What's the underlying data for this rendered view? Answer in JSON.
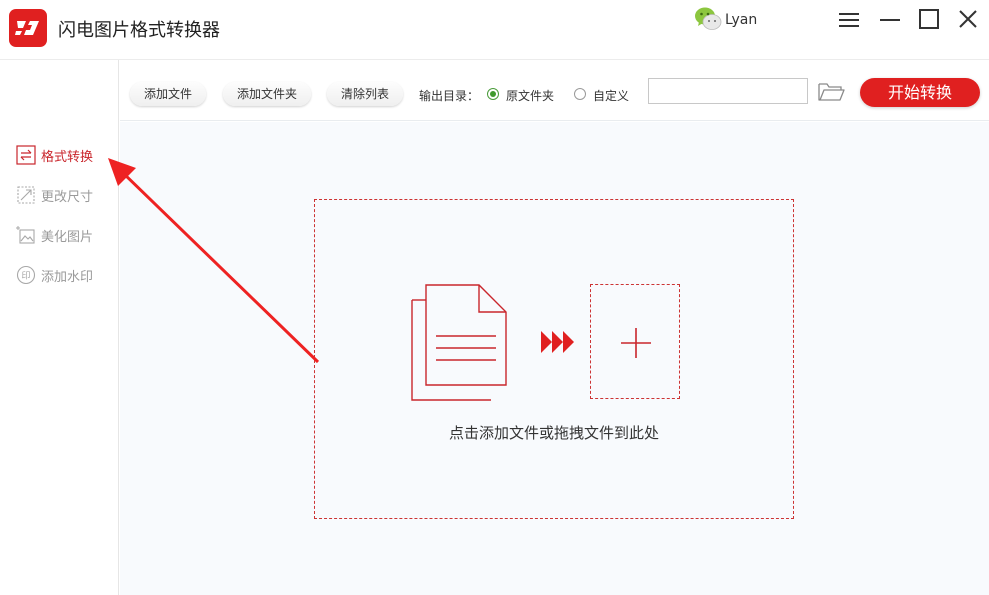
{
  "app": {
    "title": "闪电图片格式转换器",
    "user_name": "Lyan"
  },
  "colors": {
    "accent": "#e02020",
    "active_text": "#c9262c",
    "radio_checked": "#3f9a2d",
    "dropzone_border": "#cc3333"
  },
  "icons": {
    "logo": "lightning-logo-icon",
    "wechat": "wechat-icon",
    "menu": "hamburger-menu-icon",
    "minimize": "minimize-icon",
    "maximize": "maximize-icon",
    "close": "close-icon",
    "folder": "folder-open-icon"
  },
  "sidebar": {
    "items": [
      {
        "label": "格式转换",
        "icon": "convert-icon",
        "active": true
      },
      {
        "label": "更改尺寸",
        "icon": "resize-icon",
        "active": false
      },
      {
        "label": "美化图片",
        "icon": "beautify-image-icon",
        "active": false
      },
      {
        "label": "添加水印",
        "icon": "watermark-icon",
        "active": false
      }
    ]
  },
  "toolbar": {
    "add_file": "添加文件",
    "add_folder": "添加文件夹",
    "clear_list": "清除列表",
    "output_dir_label": "输出目录：",
    "output_options": [
      {
        "label": "原文件夹",
        "checked": true
      },
      {
        "label": "自定义",
        "checked": false
      }
    ],
    "path_value": "",
    "start_button": "开始转换"
  },
  "dropzone": {
    "hint": "点击添加文件或拖拽文件到此处"
  }
}
